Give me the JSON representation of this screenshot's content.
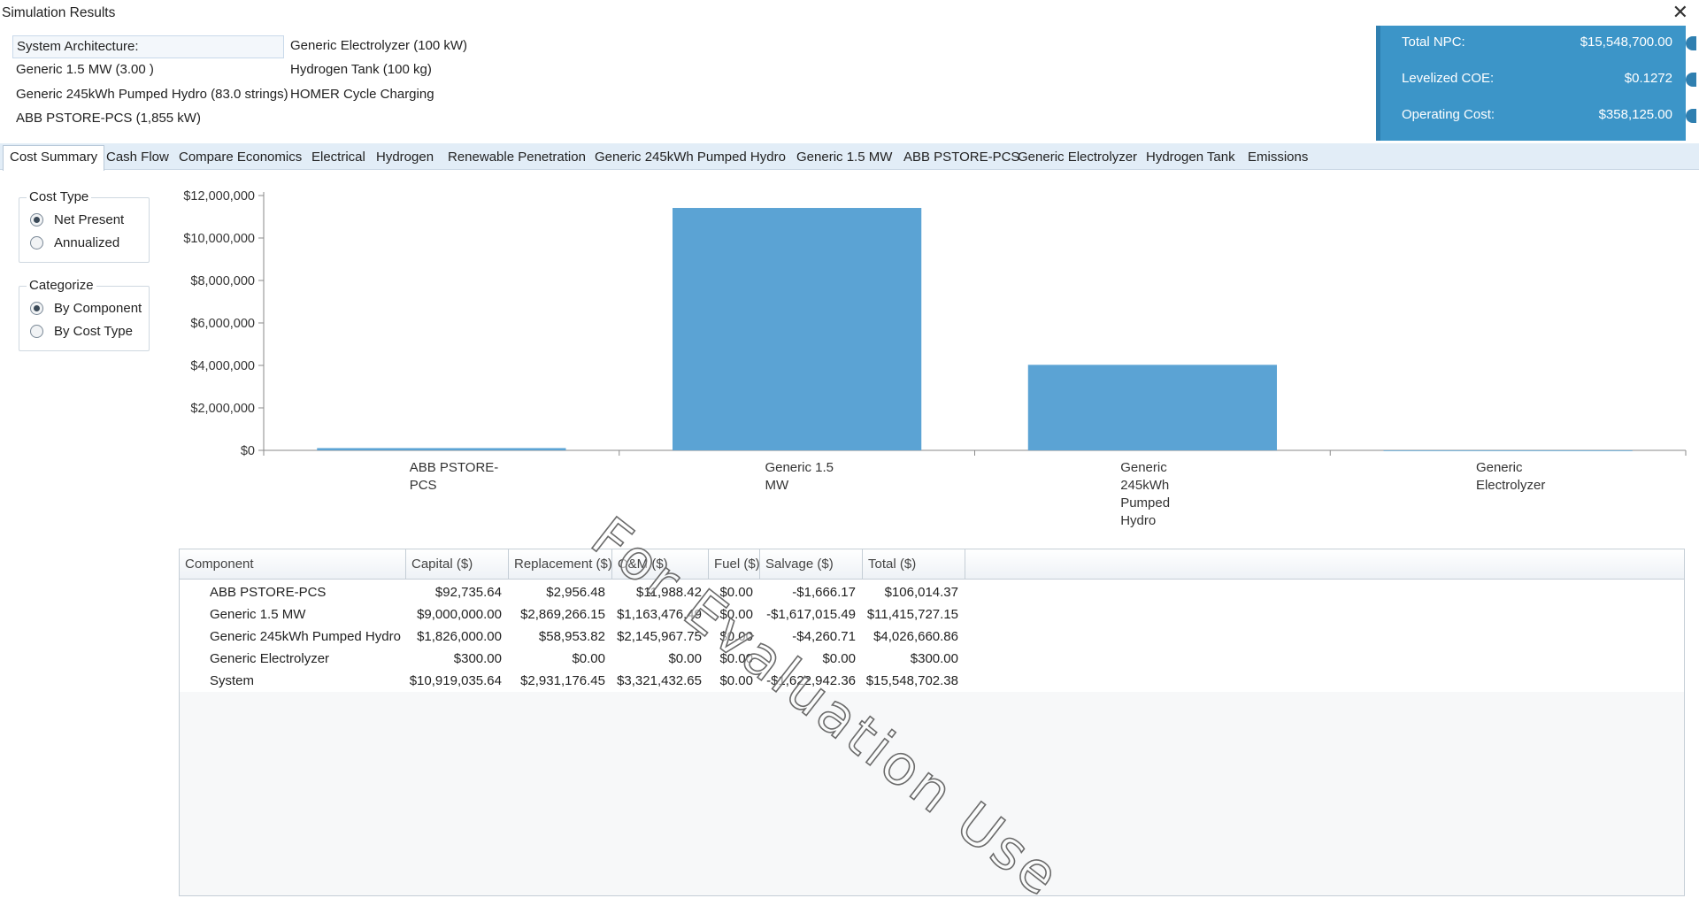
{
  "window": {
    "title": "Simulation Results",
    "close_glyph": "✕"
  },
  "architecture": {
    "col1": [
      "System Architecture:",
      "Generic 1.5 MW (3.00 )",
      "Generic 245kWh Pumped Hydro (83.0 strings)",
      "ABB PSTORE-PCS (1,855 kW)"
    ],
    "col2": [
      "Generic Electrolyzer (100 kW)",
      "Hydrogen Tank (100 kg)",
      "HOMER Cycle Charging"
    ]
  },
  "summary": {
    "background": "#3c95c8",
    "rows": [
      {
        "label": "Total NPC:",
        "value": "$15,548,700.00"
      },
      {
        "label": "Levelized COE:",
        "value": "$0.1272"
      },
      {
        "label": "Operating Cost:",
        "value": "$358,125.00"
      }
    ]
  },
  "tabs": [
    "Cost Summary",
    "Cash Flow",
    "Compare Economics",
    "Electrical",
    "Hydrogen",
    "Renewable Penetration",
    "Generic 245kWh Pumped Hydro",
    "Generic 1.5 MW",
    "ABB PSTORE-PCS",
    "Generic Electrolyzer",
    "Hydrogen Tank",
    "Emissions"
  ],
  "active_tab": "Cost Summary",
  "cost_type": {
    "title": "Cost Type",
    "options": [
      "Net Present",
      "Annualized"
    ],
    "selected": "Net Present"
  },
  "categorize": {
    "title": "Categorize",
    "options": [
      "By Component",
      "By Cost Type"
    ],
    "selected": "By Component"
  },
  "chart_data": {
    "type": "bar",
    "categories": [
      "ABB PSTORE-PCS",
      "Generic 1.5 MW",
      "Generic 245kWh Pumped Hydro",
      "Generic Electrolyzer"
    ],
    "category_lines": [
      [
        "ABB PSTORE-",
        "PCS"
      ],
      [
        "Generic 1.5",
        "MW"
      ],
      [
        "Generic",
        "245kWh",
        "Pumped",
        "Hydro"
      ],
      [
        "Generic",
        "Electrolyzer"
      ]
    ],
    "values": [
      106014.37,
      11415727.15,
      4026660.86,
      300.0
    ],
    "ylim": [
      0,
      12000000
    ],
    "yticks": [
      0,
      2000000,
      4000000,
      6000000,
      8000000,
      10000000,
      12000000
    ],
    "ytick_labels": [
      "$0",
      "$2,000,000",
      "$4,000,000",
      "$6,000,000",
      "$8,000,000",
      "$10,000,000",
      "$12,000,000"
    ],
    "bar_color": "#5ba3d4",
    "grid": false,
    "title": "",
    "xlabel": "",
    "ylabel": ""
  },
  "table": {
    "columns": [
      "Component",
      "Capital ($)",
      "Replacement ($)",
      "O&M ($)",
      "Fuel ($)",
      "Salvage ($)",
      "Total ($)"
    ],
    "rows": [
      [
        "ABB PSTORE-PCS",
        "$92,735.64",
        "$2,956.48",
        "$11,988.42",
        "$0.00",
        "-$1,666.17",
        "$106,014.37"
      ],
      [
        "Generic 1.5 MW",
        "$9,000,000.00",
        "$2,869,266.15",
        "$1,163,476.49",
        "$0.00",
        "-$1,617,015.49",
        "$11,415,727.15"
      ],
      [
        "Generic 245kWh Pumped Hydro",
        "$1,826,000.00",
        "$58,953.82",
        "$2,145,967.75",
        "$0.00",
        "-$4,260.71",
        "$4,026,660.86"
      ],
      [
        "Generic Electrolyzer",
        "$300.00",
        "$0.00",
        "$0.00",
        "$0.00",
        "$0.00",
        "$300.00"
      ],
      [
        "System",
        "$10,919,035.64",
        "$2,931,176.45",
        "$3,321,432.65",
        "$0.00",
        "-$1,622,942.36",
        "$15,548,702.38"
      ]
    ]
  },
  "watermark": "For Evaluation Use"
}
